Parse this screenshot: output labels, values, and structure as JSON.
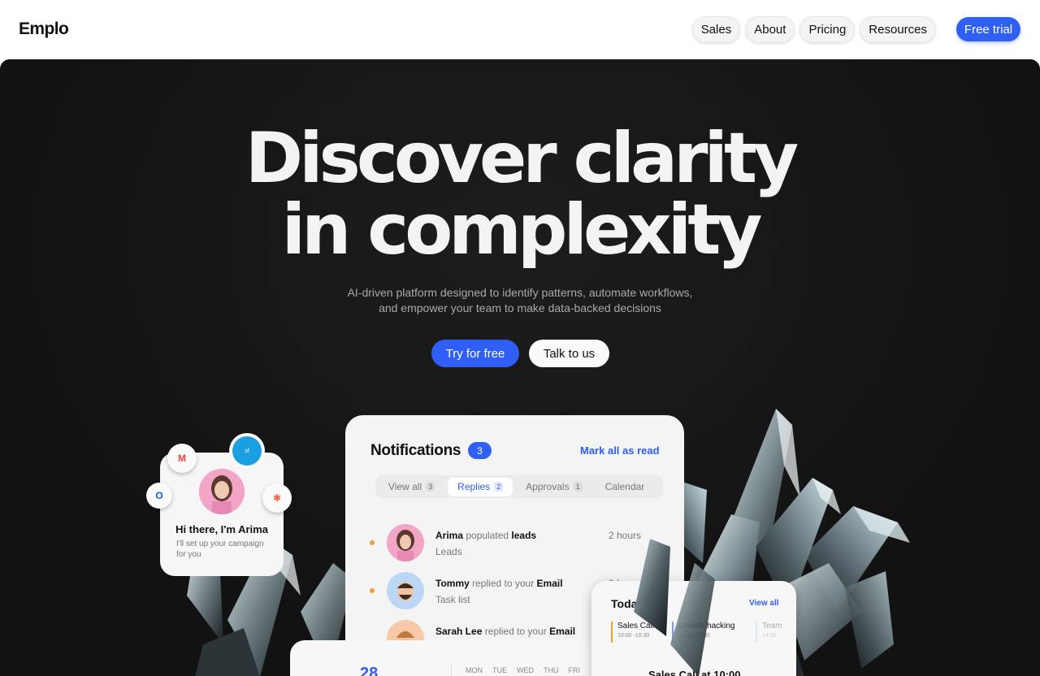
{
  "brand": {
    "logo": "Emplo"
  },
  "nav": {
    "items": [
      "Sales",
      "About",
      "Pricing",
      "Resources"
    ],
    "cta": "Free trial"
  },
  "hero": {
    "headline_line1": "Discover clarity",
    "headline_line2": "in complexity",
    "subtext_line1": "AI-driven platform designed to identify patterns, automate workflows,",
    "subtext_line2": "and empower your team to make data-backed decisions",
    "primary_cta": "Try for free",
    "secondary_cta": "Talk to us"
  },
  "assistant_card": {
    "greeting": "Hi there, I'm Arima",
    "message": "I'll set up your campaign for you"
  },
  "notifications": {
    "title": "Notifications",
    "count": "3",
    "mark_all": "Mark all as read",
    "tabs": [
      {
        "label": "View all",
        "count": "3"
      },
      {
        "label": "Replies",
        "count": "2"
      },
      {
        "label": "Approvals",
        "count": "1"
      },
      {
        "label": "Calendar",
        "count": ""
      }
    ],
    "rows": [
      {
        "name": "Arima",
        "action": "populated",
        "target": "leads",
        "detail": "Leads",
        "time": "2 hours"
      },
      {
        "name": "Tommy",
        "action": "replied to your",
        "target": "Email",
        "detail": "Task list",
        "time": "2 h"
      },
      {
        "name": "Sarah Lee",
        "action": "replied to your",
        "target": "Email",
        "detail": "",
        "time": ""
      }
    ]
  },
  "today": {
    "title": "Today",
    "view_all": "View all",
    "events": [
      {
        "name": "Sales Call",
        "time": "10:00 -10:30",
        "color": "#f29b38"
      },
      {
        "name": "Growth hacking",
        "time": "11:00 -12:30",
        "color": "#7a9cf5"
      },
      {
        "name": "Team",
        "time": "14:00",
        "color": "#b0c4f5"
      }
    ],
    "upcoming": "Sales Call at 10:00"
  },
  "calendar": {
    "date": "28",
    "days": [
      "MON",
      "TUE",
      "WED",
      "THU",
      "FRI"
    ]
  },
  "colors": {
    "accent": "#2f5ff5",
    "hero_bg": "#141414",
    "dot": "#f29b38"
  }
}
